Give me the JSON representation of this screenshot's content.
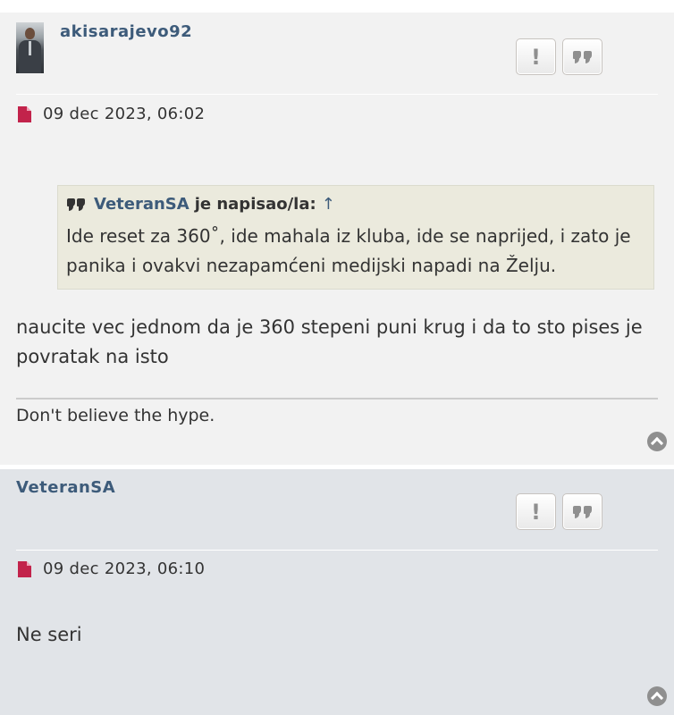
{
  "posts": [
    {
      "username": "akisarajevo92",
      "date": "09 dec 2023, 06:02",
      "report_label": "!",
      "quote": {
        "author": "VeteranSA",
        "suffix": "je napisao/la:",
        "arrow": "↑",
        "text": "Ide reset za 360˚, ide mahala iz kluba, ide se naprijed, i zato je panika i ovakvi nezapamćeni medijski napadi na Želju."
      },
      "body": "naucite vec jednom da je 360 stepeni puni krug i da to sto pises je povratak na isto",
      "signature": "Don't believe the hype."
    },
    {
      "username": "VeteranSA",
      "date": "09 dec 2023, 06:10",
      "report_label": "!",
      "body": "Ne seri"
    }
  ],
  "icons": {
    "report": "exclamation-icon",
    "quote": "quote-icon",
    "post": "post-file-icon",
    "top": "back-to-top-icon"
  },
  "colors": {
    "username": "#3d5b7a",
    "post_icon": "#c2234b",
    "post1_bg": "#f2f2f2",
    "post2_bg": "#e1e4e8",
    "quote_bg": "#ebeadd"
  }
}
